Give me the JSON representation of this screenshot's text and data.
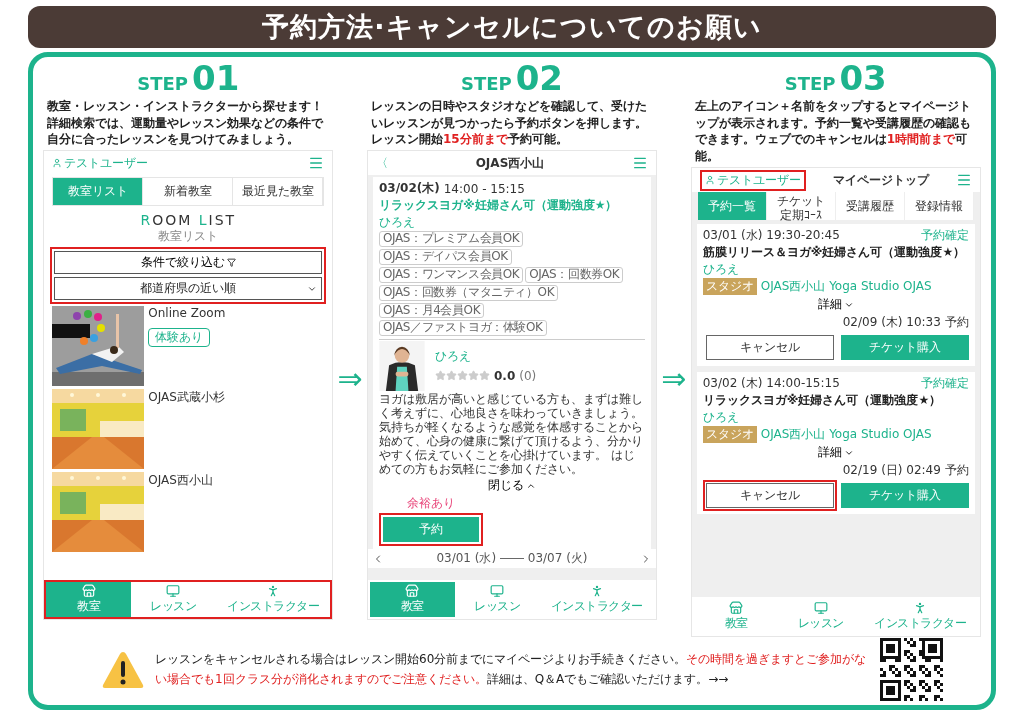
{
  "title": "予約方法·キャンセルについてのお願い",
  "arrows": [
    "⇒",
    "⇒"
  ],
  "steps": [
    {
      "label": "STEP",
      "number": "01",
      "description": "教室・レッスン・インストラクターから探せます！詳細検索では、運動量やレッスン効果などの条件で自分に合ったレッスンを見つけてみましょう。",
      "screen": {
        "kind": "room-list",
        "user": "テストユーザー",
        "tabs": [
          {
            "label": "教室リスト",
            "selected": true
          },
          {
            "label": "新着教室",
            "selected": false
          },
          {
            "label": "最近見た教室",
            "selected": false
          }
        ],
        "heading": [
          "ROOM",
          "LIST"
        ],
        "subheading": "教室リスト",
        "filters": {
          "highlighted": true,
          "button": "条件で絞り込む",
          "select": "都道府県の近い順"
        },
        "rooms": [
          {
            "name": "Online Zoom",
            "badge": "体験あり",
            "kind": "online"
          },
          {
            "name": "OJAS武蔵小杉",
            "kind": "studio"
          },
          {
            "name": "OJAS西小山",
            "kind": "studio"
          }
        ],
        "nav": {
          "highlighted": true,
          "items": [
            {
              "label": "教室",
              "selected": true
            },
            {
              "label": "レッスン",
              "selected": false
            },
            {
              "label": "インストラクター",
              "selected": false
            }
          ]
        }
      }
    },
    {
      "label": "STEP",
      "number": "02",
      "description": "レッスンの日時やスタジオなどを確認して、受けたいレッスンが見つかったら予約ボタンを押します。レッスン開始**15分前まで**予約可能。",
      "screen": {
        "kind": "lesson-detail",
        "back": "〈",
        "title": "OJAS西小山",
        "date": "03/02(木)",
        "time": "14:00 - 15:15",
        "lesson": "リラックスヨガ※妊婦さん可（運動強度★）",
        "instructor": "ひろえ",
        "tags": [
          "OJAS：プレミアム会員OK",
          "OJAS：デイパス会員OK",
          "OJAS：ワンマンス会員OK",
          "OJAS：回数券OK",
          "OJAS：回数券（マタニティ）OK",
          "OJAS：月4会員OK",
          "OJAS／ファストヨガ：体験OK"
        ],
        "profile": {
          "name": "ひろえ",
          "stars": 0,
          "rating": "0.0",
          "count": "(0)",
          "bio": "ヨガは敷居が高いと感じている方も、まずは難しく考えずに、心地良さを味わっていきましょう。気持ちが軽くなるような感覚を体感することから始めて、心身の健康に繋げて頂けるよう、分かりやすく伝えていくことを心掛けています。 はじめての方もお気軽にご参加ください。",
          "toggle": "閉じる"
        },
        "reserve": {
          "highlighted": true,
          "note": "余裕あり",
          "button": "予約"
        },
        "week": "03/01 (水) ―― 03/07 (火)",
        "nav": {
          "highlighted": false,
          "items": [
            {
              "label": "教室",
              "selected": true
            },
            {
              "label": "レッスン",
              "selected": false
            },
            {
              "label": "インストラクター",
              "selected": false
            }
          ]
        }
      }
    },
    {
      "label": "STEP",
      "number": "03",
      "description": "左上のアイコン＋名前をタップするとマイページトップが表示されます。予約一覧や受講履歴の確認もできます。ウェブでのキャンセルは**1時間前まで**可能。",
      "screen": {
        "kind": "my-page",
        "user": {
          "name": "テストユーザー",
          "highlighted": true
        },
        "title": "マイページトップ",
        "tabs": [
          {
            "label": "予約一覧",
            "selected": true
          },
          {
            "label": "チケット",
            "sub": "定期ｺｰｽ",
            "selected": false
          },
          {
            "label": "受講履歴",
            "selected": false
          },
          {
            "label": "登録情報",
            "selected": false
          }
        ],
        "bookings": [
          {
            "date": "03/01 (水) 19:30-20:45",
            "status": "予約確定",
            "lesson": "筋膜リリース＆ヨガ※妊婦さん可（運動強度★）",
            "instructor": "ひろえ",
            "tag": "スタジオ",
            "studio": "OJAS西小山  Yoga Studio OJAS",
            "details": "詳細",
            "booked": "02/09 (木) 10:33 予約",
            "cancel": "キャンセル",
            "cancel_highlighted": false,
            "buy": "チケット購入"
          },
          {
            "date": "03/02 (木) 14:00-15:15",
            "status": "予約確定",
            "lesson": "リラックスヨガ※妊婦さん可（運動強度★）",
            "instructor": "ひろえ",
            "tag": "スタジオ",
            "studio": "OJAS西小山  Yoga Studio OJAS",
            "details": "詳細",
            "booked": "02/19 (日) 02:49 予約",
            "cancel": "キャンセル",
            "cancel_highlighted": true,
            "buy": "チケット購入"
          }
        ],
        "nav": {
          "highlighted": false,
          "items": [
            {
              "label": "教室",
              "selected": false
            },
            {
              "label": "レッスン",
              "selected": false
            },
            {
              "label": "インストラクター",
              "selected": false
            }
          ]
        }
      }
    }
  ],
  "notice": {
    "text": "レッスンをキャンセルされる場合はレッスン開始60分前までにマイページよりお手続きください。**その時間を過ぎますとご参加がない場合でも1回クラス分が消化されますのでご注意ください。**詳細は、Q＆Aでもご確認いただけます。→→"
  }
}
